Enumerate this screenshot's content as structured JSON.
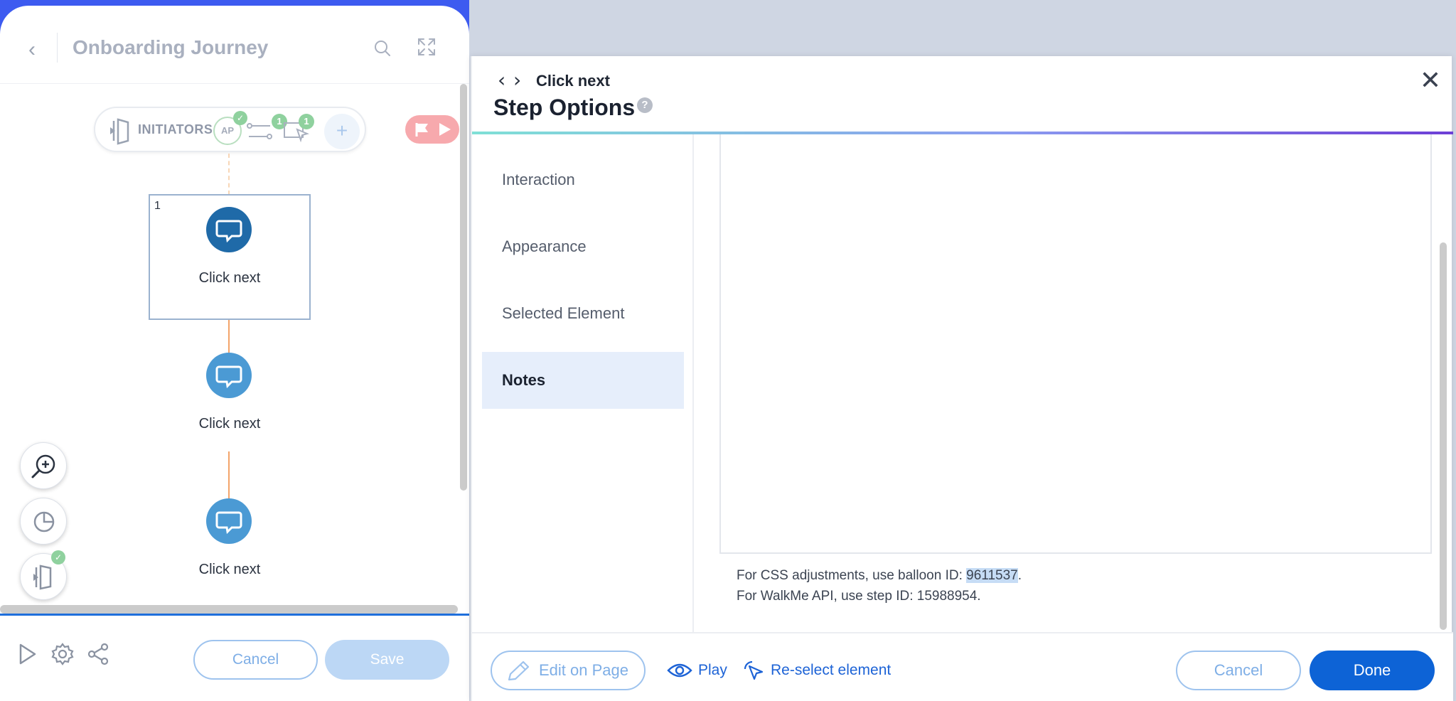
{
  "editor": {
    "title": "Onboarding Journey",
    "initiators": {
      "label": "INITIATORS",
      "ap_badge": "AP",
      "check": "✓",
      "condition_count": "1",
      "element_count": "1",
      "add": "+"
    },
    "steps": [
      {
        "number": "1",
        "label": "Click next"
      },
      {
        "label": "Click next"
      },
      {
        "label": "Click next"
      }
    ],
    "footer": {
      "cancel_label": "Cancel",
      "save_label": "Save"
    }
  },
  "step_options": {
    "breadcrumb": "Click next",
    "title": "Step Options",
    "help": "?",
    "close": "✕",
    "menu": [
      {
        "label": "Interaction"
      },
      {
        "label": "Appearance"
      },
      {
        "label": "Selected Element"
      },
      {
        "label": "Notes"
      }
    ],
    "css_note_prefix": "For CSS adjustments, use balloon ID: ",
    "balloon_id": "9611537",
    "css_note_suffix": ".",
    "api_note": "For WalkMe API, use step ID: 15988954.",
    "footer": {
      "edit_label": "Edit on Page",
      "play_label": "Play",
      "reselect_label": "Re-select element",
      "cancel_label": "Cancel",
      "done_label": "Done"
    }
  },
  "colors": {
    "accent": "#3d5bf0",
    "primary_button": "#0d63d6",
    "link": "#1d63d6",
    "step_dark": "#1f6aa8",
    "step_light": "#4b9ad4"
  }
}
